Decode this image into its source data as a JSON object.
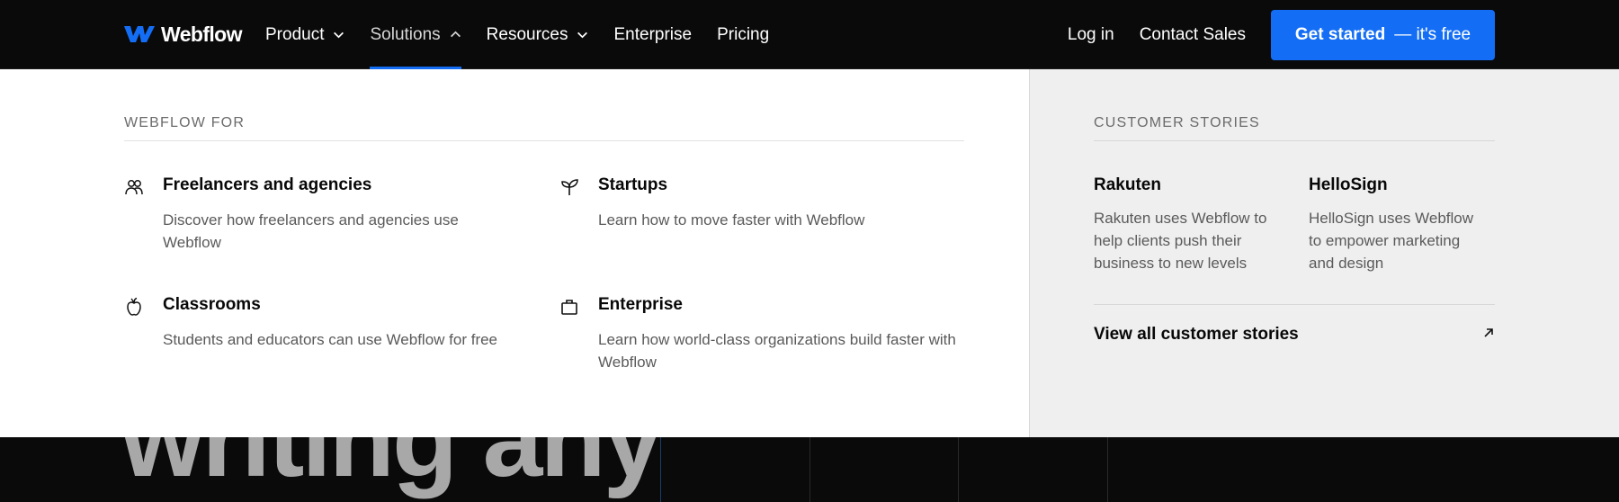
{
  "header": {
    "logo_text": "Webflow",
    "nav": [
      {
        "label": "Product",
        "has_dropdown": true,
        "open": false
      },
      {
        "label": "Solutions",
        "has_dropdown": true,
        "open": true
      },
      {
        "label": "Resources",
        "has_dropdown": true,
        "open": false
      },
      {
        "label": "Enterprise",
        "has_dropdown": false
      },
      {
        "label": "Pricing",
        "has_dropdown": false
      }
    ],
    "login": "Log in",
    "contact": "Contact Sales",
    "cta_main": "Get started",
    "cta_sub": "— it's free"
  },
  "dropdown": {
    "left_heading": "WEBFLOW FOR",
    "items": [
      {
        "icon": "people-icon",
        "title": "Freelancers and agencies",
        "desc": "Discover how freelancers and agencies use Webflow"
      },
      {
        "icon": "sprout-icon",
        "title": "Startups",
        "desc": "Learn how to move faster with Webflow"
      },
      {
        "icon": "apple-icon",
        "title": "Classrooms",
        "desc": "Students and educators can use Webflow for free"
      },
      {
        "icon": "briefcase-icon",
        "title": "Enterprise",
        "desc": "Learn how world-class organizations build faster with Webflow"
      }
    ],
    "right_heading": "CUSTOMER STORIES",
    "stories": [
      {
        "title": "Rakuten",
        "desc": "Rakuten uses Webflow to help clients push their business to new levels"
      },
      {
        "title": "HelloSign",
        "desc": "HelloSign uses Webflow to empower marketing and design"
      }
    ],
    "view_all": "View all customer stories"
  },
  "hero": {
    "partial_text": "writing any"
  },
  "colors": {
    "accent": "#146ef5",
    "header_bg": "#0a0a0a",
    "panel_right_bg": "#efefef"
  }
}
